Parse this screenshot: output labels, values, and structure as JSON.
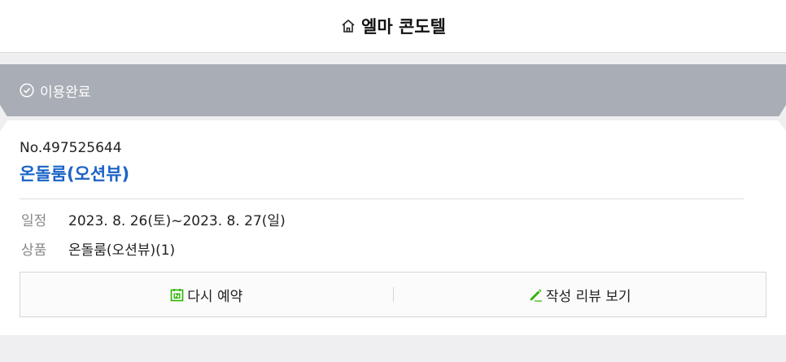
{
  "header": {
    "title": "엘마 콘도텔",
    "icon": "home-icon"
  },
  "status": {
    "label": "이용완료",
    "icon": "check-circle-icon"
  },
  "booking": {
    "order_no": "No.497525644",
    "room_name": "온돌룸(오션뷰)",
    "schedule_label": "일정",
    "schedule_value": "2023. 8. 26(토)~2023. 8. 27(일)",
    "product_label": "상품",
    "product_value": "온돌룸(오션뷰)(1)"
  },
  "actions": {
    "rebook_label": "다시 예약",
    "review_label": "작성 리뷰 보기",
    "rebook_icon_color": "#2db400",
    "review_icon_color": "#2db400"
  }
}
